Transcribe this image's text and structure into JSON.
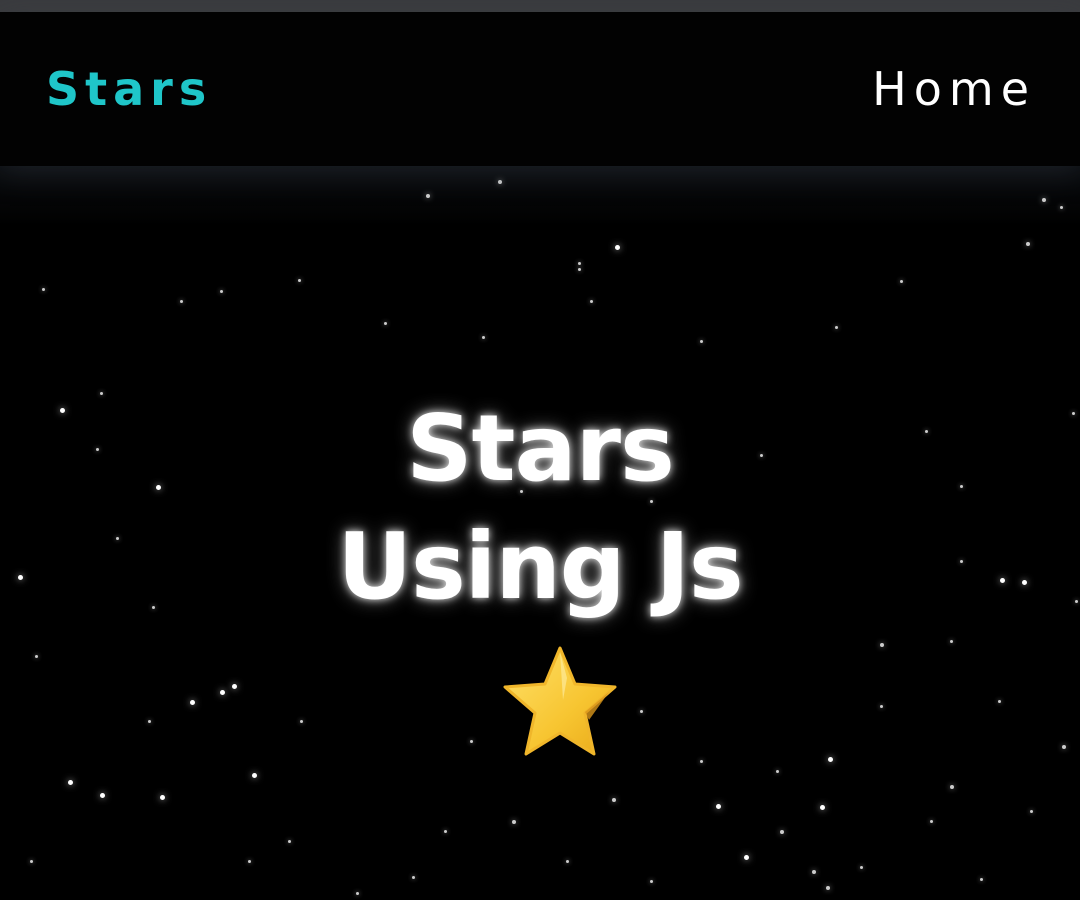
{
  "navbar": {
    "brand": "Stars",
    "links": [
      {
        "label": "Home"
      }
    ]
  },
  "hero": {
    "title_line1": "Stars",
    "title_line2": "Using Js",
    "emoji_icon": "star-emoji"
  },
  "colors": {
    "brand": "#1fc6c9",
    "background": "#000000",
    "text": "#ffffff",
    "star_fill": "#f7c531"
  }
}
